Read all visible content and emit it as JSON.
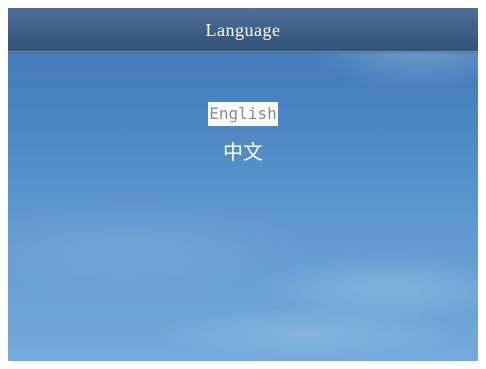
{
  "header": {
    "title": "Language"
  },
  "language_menu": {
    "selected_index": 0,
    "items": [
      {
        "label": "English"
      },
      {
        "label": "中文"
      }
    ]
  },
  "colors": {
    "background_sky": "#4a85c2",
    "titlebar": "#3d5d87",
    "text": "#ffffff",
    "selection_background": "#ffffff",
    "selection_text": "#8a8a8a"
  }
}
